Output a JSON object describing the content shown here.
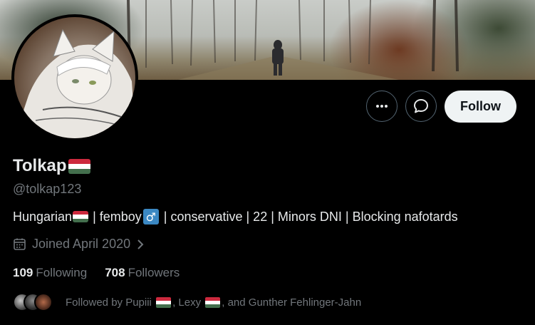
{
  "profile": {
    "display_name": "Tolkap",
    "handle": "@tolkap123",
    "bio_parts": {
      "part1": "Hungarian",
      "part2": " | femboy",
      "male_symbol": "♂",
      "part3": " | conservative | 22 | Minors DNI | Blocking nafotards"
    },
    "joined": "Joined April 2020",
    "following_count": "109",
    "following_label": "Following",
    "followers_count": "708",
    "followers_label": "Followers",
    "followed_by": {
      "prefix": "Followed by Pupiii ",
      "sep1": ", Lexy ",
      "suffix": ", and Gunther Fehlinger-Jahn"
    }
  },
  "actions": {
    "follow_label": "Follow",
    "more_icon": "more-dots-icon",
    "message_icon": "message-bubble-icon"
  },
  "icons": {
    "calendar": "calendar-icon",
    "chevron": "chevron-right-icon",
    "flag": "hungary-flag-icon"
  },
  "colors": {
    "background": "#000000",
    "text_primary": "#e7e9ea",
    "text_secondary": "#71767b",
    "follow_bg": "#eff3f4",
    "border": "#536471"
  }
}
